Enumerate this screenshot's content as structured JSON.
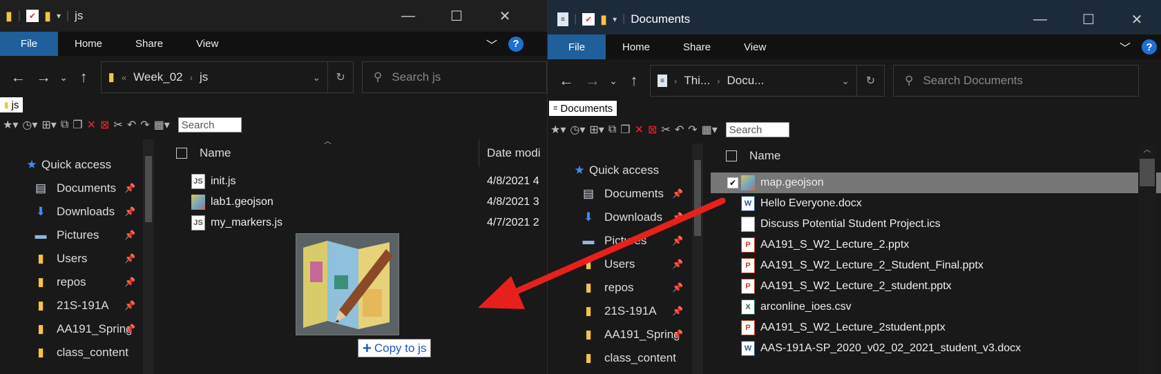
{
  "left_window": {
    "title": "js",
    "ribbon_tabs": [
      "File",
      "Home",
      "Share",
      "View"
    ],
    "breadcrumb": [
      "Week_02",
      "js"
    ],
    "breadcrumb_sep": "«",
    "search_placeholder": "Search js",
    "crumb_tab": "js",
    "toolbar_search": "Search",
    "nav_items": [
      {
        "label": "Quick access",
        "icon": "star-icon"
      },
      {
        "label": "Documents",
        "icon": "documents-icon",
        "pinned": true
      },
      {
        "label": "Downloads",
        "icon": "downloads-icon",
        "pinned": true
      },
      {
        "label": "Pictures",
        "icon": "pictures-icon",
        "pinned": true
      },
      {
        "label": "Users",
        "icon": "folder-icon",
        "pinned": true
      },
      {
        "label": "repos",
        "icon": "folder-icon",
        "pinned": true
      },
      {
        "label": "21S-191A",
        "icon": "folder-icon",
        "pinned": true
      },
      {
        "label": "AA191_Spring",
        "icon": "folder-icon",
        "pinned": true
      },
      {
        "label": "class_content",
        "icon": "folder-icon"
      }
    ],
    "columns": [
      "Name",
      "Date modi"
    ],
    "files": [
      {
        "name": "init.js",
        "date": "4/8/2021 4",
        "type": "js"
      },
      {
        "name": "lab1.geojson",
        "date": "4/8/2021 3",
        "type": "geo"
      },
      {
        "name": "my_markers.js",
        "date": "4/7/2021 2",
        "type": "js"
      }
    ]
  },
  "right_window": {
    "title": "Documents",
    "ribbon_tabs": [
      "File",
      "Home",
      "Share",
      "View"
    ],
    "breadcrumb": [
      "Thi...",
      "Docu..."
    ],
    "search_placeholder": "Search Documents",
    "crumb_tab": "Documents",
    "toolbar_search": "Search",
    "nav_items": [
      {
        "label": "Quick access",
        "icon": "star-icon"
      },
      {
        "label": "Documents",
        "icon": "documents-icon",
        "pinned": true
      },
      {
        "label": "Downloads",
        "icon": "downloads-icon",
        "pinned": true
      },
      {
        "label": "Pictures",
        "icon": "pictures-icon",
        "pinned": true
      },
      {
        "label": "Users",
        "icon": "folder-icon",
        "pinned": true
      },
      {
        "label": "repos",
        "icon": "folder-icon",
        "pinned": true
      },
      {
        "label": "21S-191A",
        "icon": "folder-icon",
        "pinned": true
      },
      {
        "label": "AA191_Spring",
        "icon": "folder-icon",
        "pinned": true
      },
      {
        "label": "class_content",
        "icon": "folder-icon"
      }
    ],
    "columns": [
      "Name"
    ],
    "files": [
      {
        "name": "map.geojson",
        "type": "geo",
        "selected": true
      },
      {
        "name": "Hello Everyone.docx",
        "type": "word"
      },
      {
        "name": "Discuss Potential Student Project.ics",
        "type": "ics"
      },
      {
        "name": "AA191_S_W2_Lecture_2.pptx",
        "type": "ppt"
      },
      {
        "name": "AA191_S_W2_Lecture_2_Student_Final.pptx",
        "type": "ppt"
      },
      {
        "name": "AA191_S_W2_Lecture_2_student.pptx",
        "type": "ppt"
      },
      {
        "name": "arconline_ioes.csv",
        "type": "xls"
      },
      {
        "name": "AA191_S_W2_Lecture_2student.pptx",
        "type": "ppt"
      },
      {
        "name": "AAS-191A-SP_2020_v02_02_2021_student_v3.docx",
        "type": "word"
      }
    ]
  },
  "drag_tooltip": {
    "plus": "+",
    "label": "Copy to js"
  },
  "colors": {
    "arrow": "#e8201c",
    "file_tab": "#1f5f9a",
    "selection": "#777777",
    "help": "#1f6fd1"
  }
}
